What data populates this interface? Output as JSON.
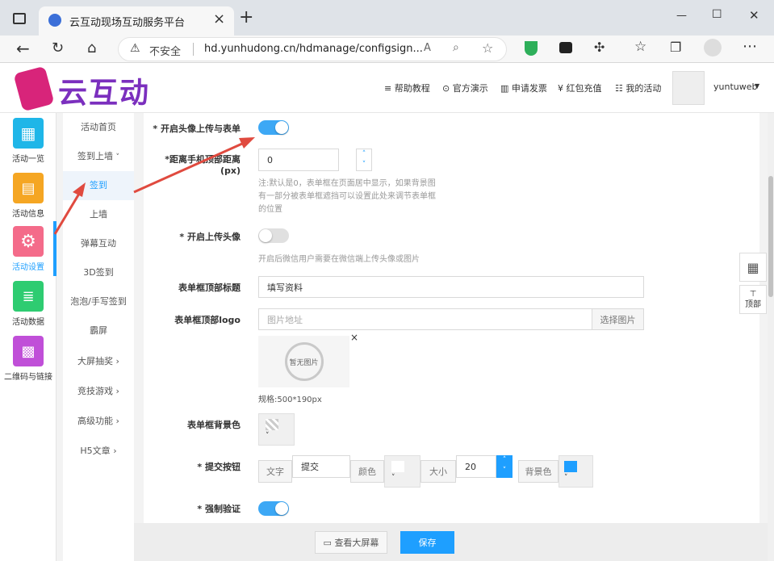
{
  "browser": {
    "tab_title": "云互动现场互动服务平台",
    "tab_close": "×",
    "new_tab": "+",
    "security_label": "不安全",
    "url": "hd.yunhudong.cn/hdmanage/configsign...",
    "window_min": "—",
    "window_max": "☐",
    "window_close": "✕"
  },
  "header": {
    "logo_text": "云互动",
    "nav": [
      "帮助教程",
      "官方演示",
      "申请发票",
      "红包充值",
      "我的活动"
    ],
    "username": "yuntuweb"
  },
  "icon_sidebar": [
    {
      "label": "活动一览",
      "color": "#1fb6e8",
      "icon": "grid-icon"
    },
    {
      "label": "活动信息",
      "color": "#f5a623",
      "icon": "document-icon"
    },
    {
      "label": "活动设置",
      "color": "#f46b8a",
      "icon": "gear-icon"
    },
    {
      "label": "活动数据",
      "color": "#2ecc71",
      "icon": "database-icon"
    },
    {
      "label": "二维码与链接",
      "color": "#c04fd8",
      "icon": "qrcode-icon"
    }
  ],
  "sub_sidebar": [
    {
      "label": "活动首页"
    },
    {
      "label": "签到上墙",
      "chevron": "˅"
    },
    {
      "label": "签到"
    },
    {
      "label": "上墙"
    },
    {
      "label": "弹幕互动"
    },
    {
      "label": "3D签到"
    },
    {
      "label": "泡泡/手写签到"
    },
    {
      "label": "霸屏"
    },
    {
      "label": "大屏抽奖",
      "chevron": "›"
    },
    {
      "label": "竞技游戏",
      "chevron": "›"
    },
    {
      "label": "高级功能",
      "chevron": "›"
    },
    {
      "label": "H5文章",
      "chevron": "›"
    }
  ],
  "form": {
    "avatar_upload_label": "* 开启头像上传与表单",
    "distance_label_1": "*距离手机顶部距离",
    "distance_label_2": "(px)",
    "distance_value": "0",
    "distance_hint": "注:默认是0，表单框在页面居中显示，如果背景图有一部分被表单框遮挡可以设置此处来调节表单框的位置",
    "upload_avatar_label": "* 开启上传头像",
    "upload_avatar_hint": "开启后微信用户需要在微信端上传头像或图片",
    "form_title_label": "表单框顶部标题",
    "form_title_value": "填写资料",
    "form_logo_label": "表单框顶部logo",
    "form_logo_placeholder": "图片地址",
    "choose_image": "选择图片",
    "no_image": "暂无图片",
    "remove_image": "×",
    "spec_text": "规格:500*190px",
    "bg_color_label": "表单框背景色",
    "submit_label": "* 提交按钮",
    "text_addon": "文字",
    "submit_text": "提交",
    "color_addon": "颜色",
    "size_addon": "大小",
    "size_value": "20",
    "bgcolor_addon": "背景色",
    "force_verify_label": "* 强制验证",
    "dropdown_caret": "˅",
    "arrow_up": "˄",
    "arrow_down": "˅"
  },
  "float_buttons": {
    "top": "顶部",
    "top_glyph": "⊤"
  },
  "bottom": {
    "view_screen": "查看大屏幕",
    "save": "保存"
  },
  "colors": {
    "accent": "#1e9fff",
    "toggle_on": "#3da8f5",
    "toggle_off": "#e0e0e0",
    "arrow": "#e04a3f",
    "logo": "#7b2fbe"
  }
}
